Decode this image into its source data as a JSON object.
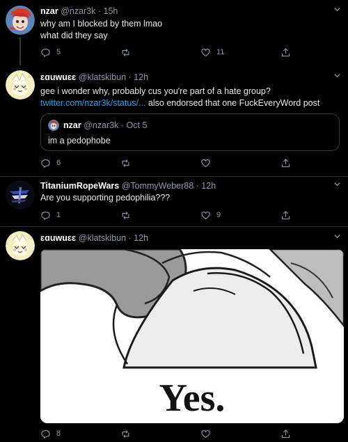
{
  "tweets": [
    {
      "name": "nzar",
      "handle": "@nzar3k",
      "time": "· 15h",
      "lines": [
        "why am I blocked by them lmao",
        "what did they say"
      ],
      "replies": "5",
      "retweets": "",
      "likes": "11"
    },
    {
      "name": "ɛɑuwuɛɛ",
      "handle": "@klatskibun",
      "time": "· 12h",
      "line1": "gee i wonder why, probably cus you're part of a hate group?",
      "link": "twitter.com/nzar3k/status/...",
      "line2_rest": " also endorsed that one FuckEveryWord post",
      "quote": {
        "name": "nzar",
        "handle": "@nzar3k",
        "time": "· Oct 5",
        "text": "im a pedophobe"
      },
      "replies": "6",
      "retweets": "",
      "likes": ""
    },
    {
      "name": "TitaniumRopeWars",
      "handle": "@TommyWeber88",
      "time": "· 12h",
      "text": "Are you supporting pedophilia???",
      "replies": "1",
      "retweets": "",
      "likes": "9"
    },
    {
      "name": "ɛɑuwuɛɛ",
      "handle": "@klatskibun",
      "time": "· 12h",
      "image_caption": "Yes.",
      "replies": "8",
      "retweets": "",
      "likes": ""
    }
  ],
  "colors": {
    "background": "#000000",
    "text": "#d9d9d9",
    "secondary": "#8899a6",
    "link": "#1da1f2",
    "divider": "#2b2b2b"
  },
  "icons": [
    "reply-icon",
    "retweet-icon",
    "like-icon",
    "share-icon",
    "chevron-down-icon"
  ]
}
